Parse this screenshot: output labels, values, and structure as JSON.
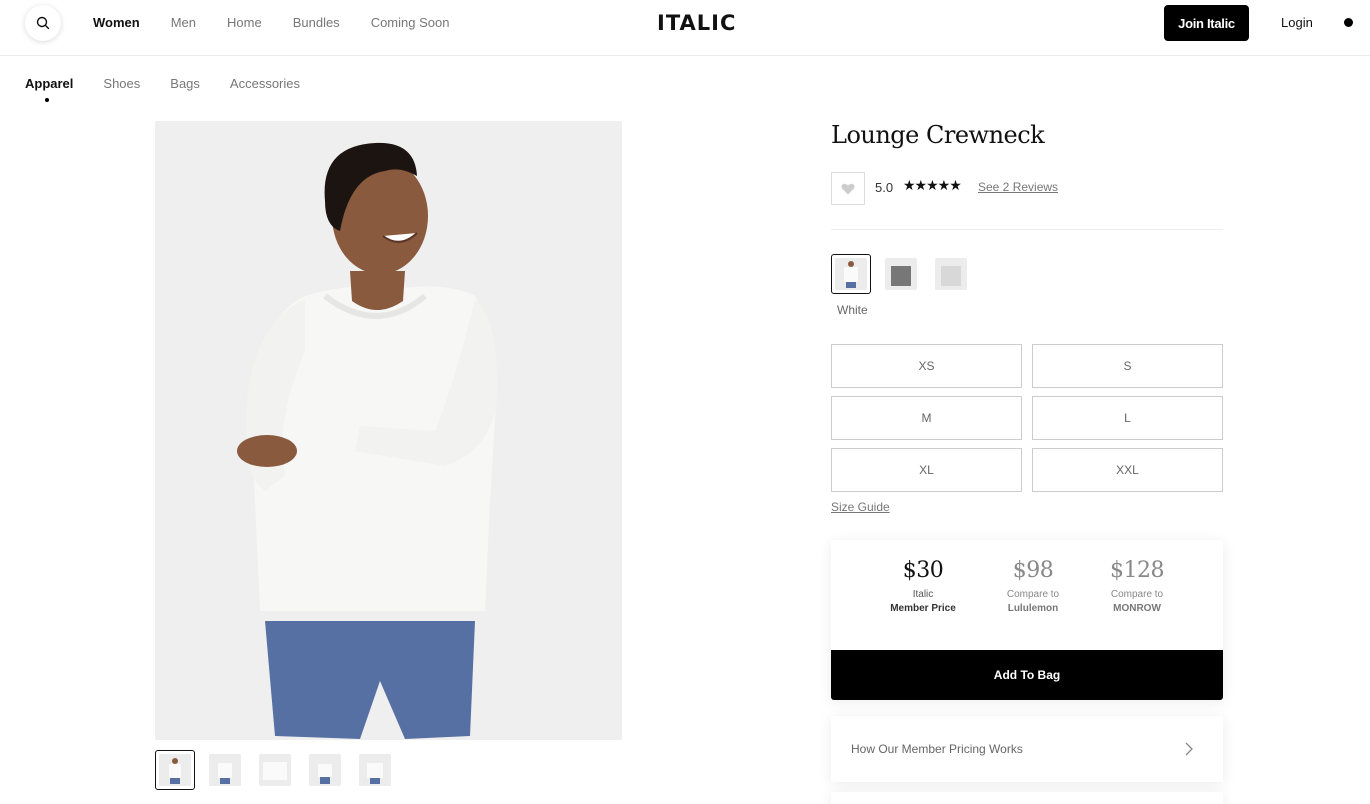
{
  "header": {
    "nav": [
      "Women",
      "Men",
      "Home",
      "Bundles",
      "Coming Soon"
    ],
    "logo": "ITALIC",
    "join_label": "Join Italic",
    "login_label": "Login"
  },
  "subnav": [
    "Apparel",
    "Shoes",
    "Bags",
    "Accessories"
  ],
  "product": {
    "title": "Lounge Crewneck",
    "rating": "5.0",
    "stars": "★★★★★",
    "reviews_label": "See 2 Reviews",
    "selected_color": "White",
    "swatch_icons": [
      "white-sweater-swatch",
      "gray-sweater-swatch",
      "light-gray-sweater-swatch"
    ],
    "sizes": [
      "XS",
      "S",
      "M",
      "L",
      "XL",
      "XXL"
    ],
    "size_guide_label": "Size Guide"
  },
  "pricing": {
    "columns": [
      {
        "price": "$30",
        "line1": "Italic",
        "line2": "Member Price"
      },
      {
        "price": "$98",
        "line1": "Compare to",
        "line2": "Lululemon"
      },
      {
        "price": "$128",
        "line1": "Compare to",
        "line2": "MONROW"
      }
    ],
    "add_label": "Add To Bag",
    "how_label": "How Our Member Pricing Works"
  },
  "colors": {
    "accent": "#000000",
    "shorts": "#5670a3",
    "sweater": "#f7f7f5",
    "background_photo": "#efefef"
  }
}
